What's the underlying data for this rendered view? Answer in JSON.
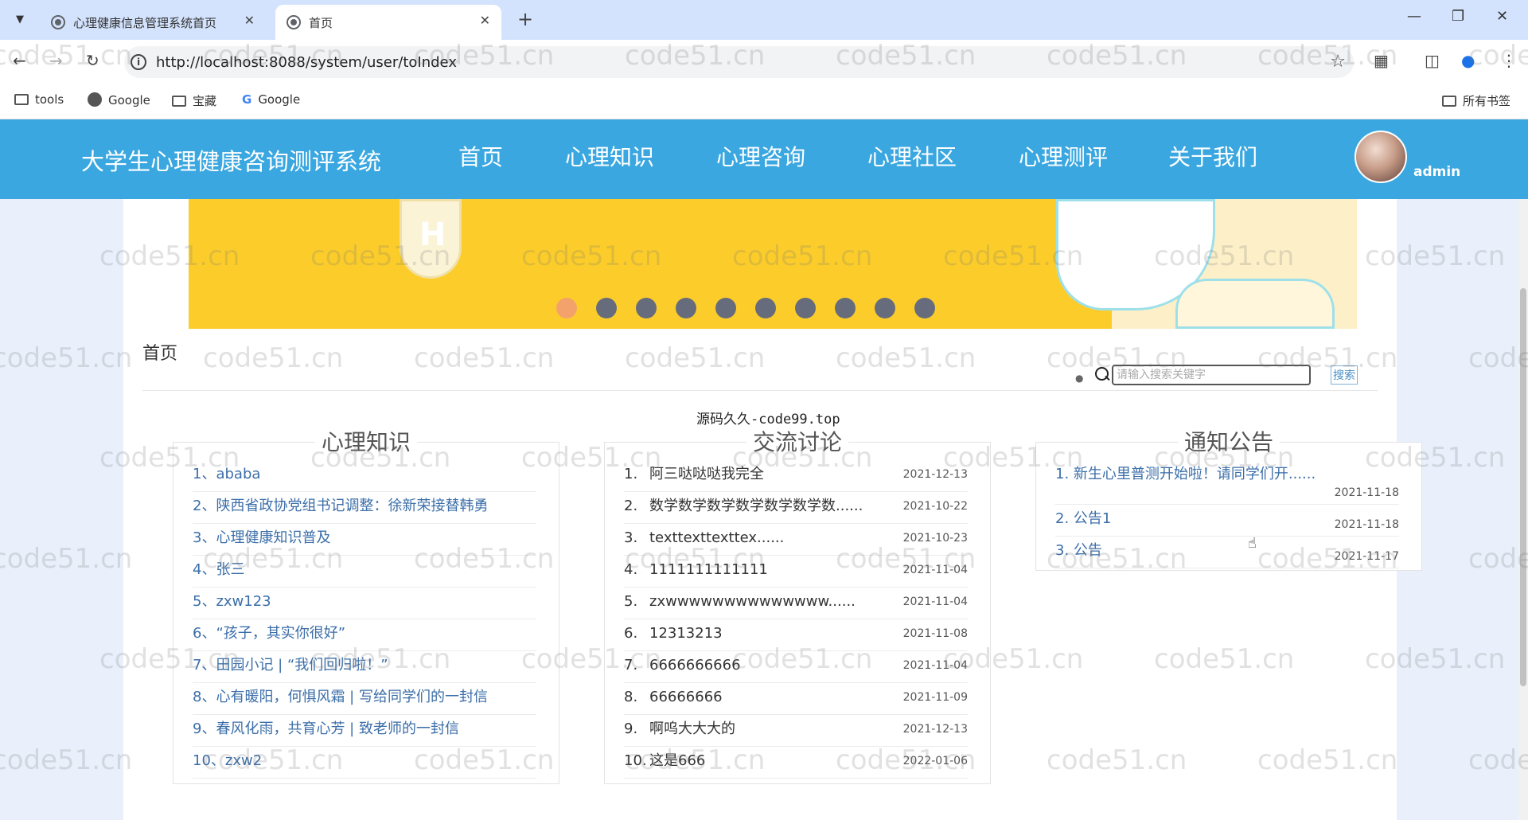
{
  "browser": {
    "tabs": [
      {
        "title": "心理健康信息管理系统首页",
        "active": false
      },
      {
        "title": "首页",
        "active": true
      }
    ],
    "url": "http://localhost:8088/system/user/toIndex",
    "bookmarks": [
      "tools",
      "Google",
      "宝藏",
      "Google"
    ],
    "all_bookmarks": "所有书签"
  },
  "site": {
    "title": "大学生心理健康咨询测评系统",
    "nav": [
      "首页",
      "心理知识",
      "心理咨询",
      "心理社区",
      "心理测评",
      "关于我们"
    ],
    "user": "admin"
  },
  "carousel": {
    "dot_count": 10,
    "active_index": 0
  },
  "breadcrumb": "首页",
  "search": {
    "placeholder": "请输入搜索关键字",
    "button": "搜索"
  },
  "source_note": "源码久久-code99.top",
  "knowledge": {
    "title": "心理知识",
    "items": [
      "1、ababa",
      "2、陕西省政协党组书记调整：徐新荣接替韩勇",
      "3、心理健康知识普及",
      "4、张三",
      "5、zxw123",
      "6、“孩子，其实你很好”",
      "7、田园小记 | “我们回归啦！”",
      "8、心有暖阳，何惧风霜 | 写给同学们的一封信",
      "9、春风化雨，共育心芳 | 致老师的一封信",
      "10、zxw2"
    ]
  },
  "discussion": {
    "title": "交流讨论",
    "items": [
      {
        "num": "1.",
        "text": "阿三哒哒哒我完全",
        "date": "2021-12-13"
      },
      {
        "num": "2.",
        "text": "数学数学数学数学数学数学数......",
        "date": "2021-10-22"
      },
      {
        "num": "3.",
        "text": "texttexttexttex......",
        "date": "2021-10-23"
      },
      {
        "num": "4.",
        "text": "1111111111111",
        "date": "2021-11-04"
      },
      {
        "num": "5.",
        "text": "zxwwwwwwwwwwwwww......",
        "date": "2021-11-04"
      },
      {
        "num": "6.",
        "text": "12313213",
        "date": "2021-11-08"
      },
      {
        "num": "7.",
        "text": "6666666666",
        "date": "2021-11-04"
      },
      {
        "num": "8.",
        "text": "66666666",
        "date": "2021-11-09"
      },
      {
        "num": "9.",
        "text": "啊呜大大大的",
        "date": "2021-12-13"
      },
      {
        "num": "10.",
        "text": "这是666",
        "date": "2022-01-06"
      }
    ]
  },
  "notices": {
    "title": "通知公告",
    "items": [
      {
        "text": "1. 新生心里普测开始啦！请同学们开......",
        "date": "2021-11-18"
      },
      {
        "text": "2. 公告1",
        "date": "2021-11-18"
      },
      {
        "text": "3. 公告",
        "date": "2021-11-17"
      }
    ]
  },
  "watermark": "code51.cn",
  "colors": {
    "header": "#3aa7e0",
    "banner": "#fccd2a",
    "link": "#3b6ea8",
    "dot_active": "#f4a26b",
    "dot": "#676c7c"
  }
}
